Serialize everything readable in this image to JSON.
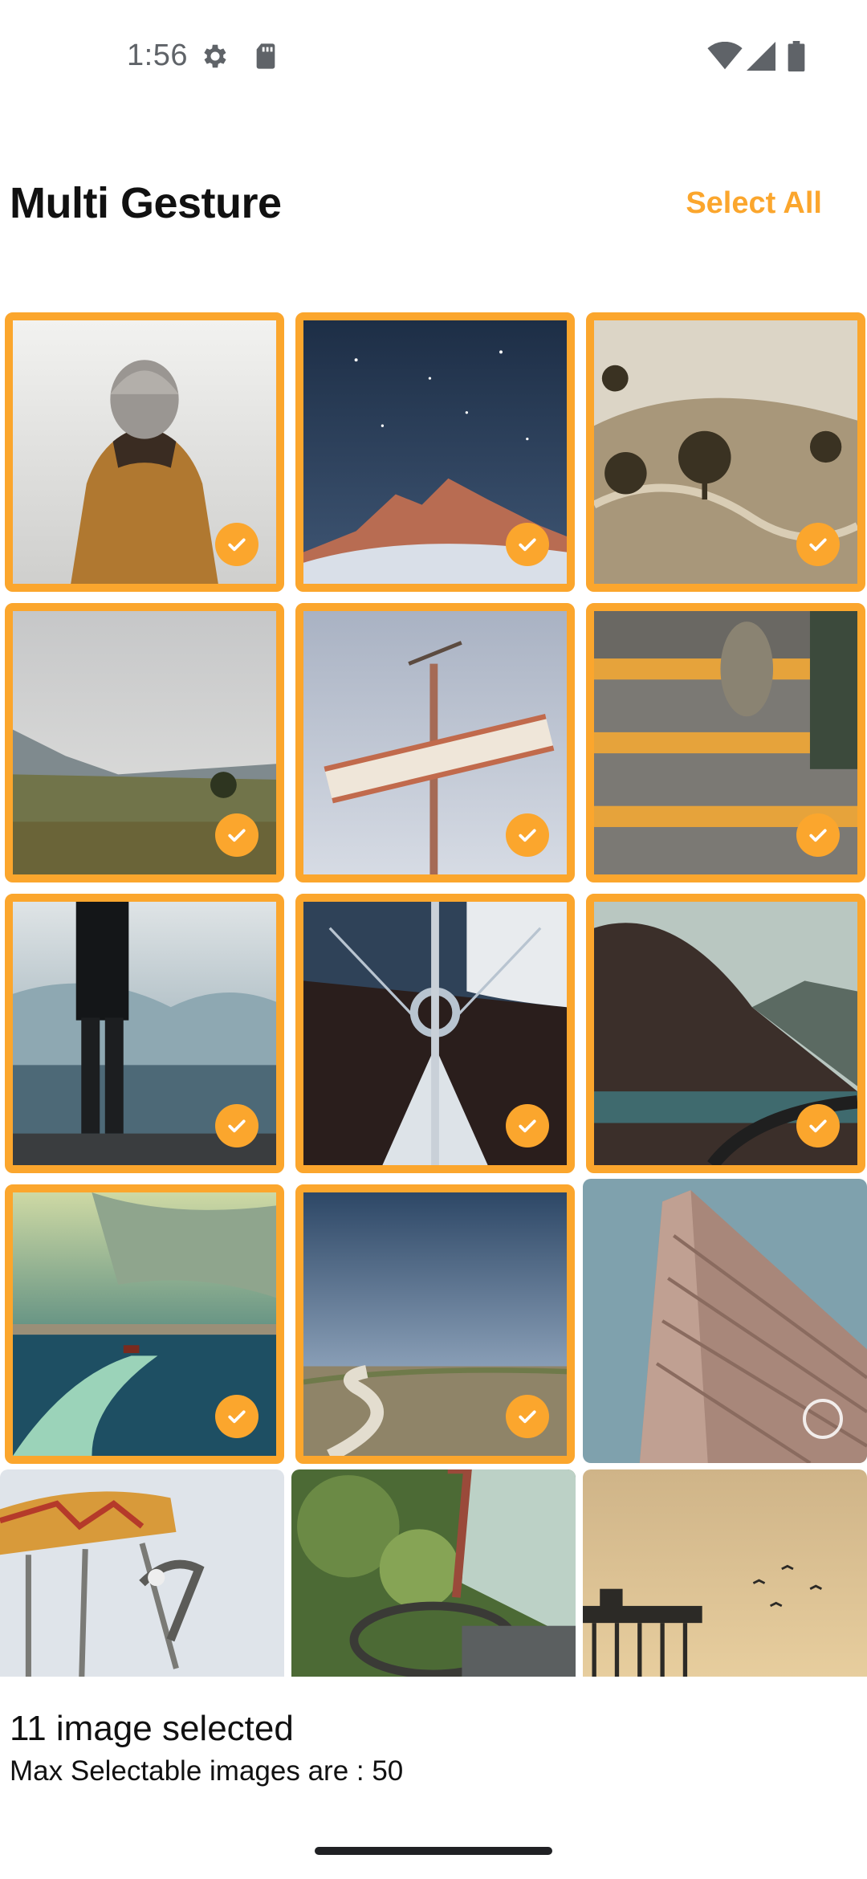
{
  "status_bar": {
    "time": "1:56",
    "icons_left": [
      "settings-icon",
      "sd-card-icon"
    ],
    "icons_right": [
      "wifi-icon",
      "cellular-signal-icon",
      "battery-icon"
    ]
  },
  "app_bar": {
    "title": "Multi Gesture",
    "action_label": "Select All"
  },
  "colors": {
    "accent": "#FBA62D",
    "text": "#111111",
    "status_text": "#5f6368"
  },
  "images": [
    {
      "subject": "person in beanie and brown hooded jacket",
      "selected": true
    },
    {
      "subject": "starry night sky over snowy mountain",
      "selected": true
    },
    {
      "subject": "sepia hills with trees and winding road",
      "selected": true
    },
    {
      "subject": "grassy valley with cloudy mountains",
      "selected": true
    },
    {
      "subject": "motel sign against sky",
      "selected": true
    },
    {
      "subject": "yellow striped stairs with shoe",
      "selected": true
    },
    {
      "subject": "person standing on pier over misty lake",
      "selected": true
    },
    {
      "subject": "sailboat bow with sail",
      "selected": true
    },
    {
      "subject": "mountain road by lake",
      "selected": true
    },
    {
      "subject": "boat wake on sea under clouds",
      "selected": true
    },
    {
      "subject": "dirt road through field under blue sky",
      "selected": true
    },
    {
      "subject": "flatiron building",
      "selected": false
    },
    {
      "subject": "bicycle with patterned blanket",
      "selected": false
    },
    {
      "subject": "old truck steering wheel with greenery",
      "selected": false
    },
    {
      "subject": "pier at sunset with birds",
      "selected": false
    }
  ],
  "footer": {
    "selected_text": "11 image selected",
    "max_text": "Max Selectable images are : 50"
  }
}
